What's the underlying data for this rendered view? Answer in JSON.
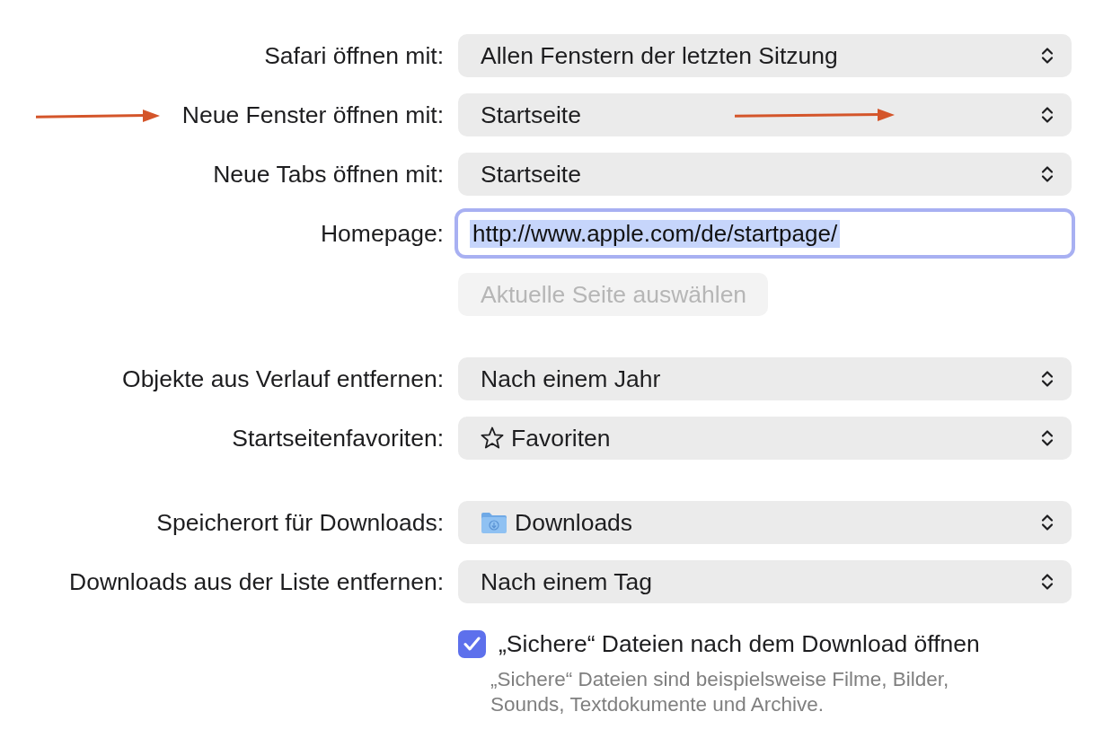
{
  "sections": [
    {
      "rows": [
        {
          "kind": "popup",
          "label": "Safari öffnen mit:",
          "value": "Allen Fenstern der letzten Sitzung",
          "annotated": false
        },
        {
          "kind": "popup",
          "label": "Neue Fenster öffnen mit:",
          "value": "Startseite",
          "annotated": true
        },
        {
          "kind": "popup",
          "label": "Neue Tabs öffnen mit:",
          "value": "Startseite",
          "annotated": false
        },
        {
          "kind": "text_field",
          "label": "Homepage:",
          "value": "http://www.apple.com/de/startpage/",
          "focused": true,
          "text_selected": true,
          "annotated": false
        },
        {
          "kind": "button",
          "text": "Aktuelle Seite auswählen",
          "disabled": true,
          "annotated": false
        }
      ]
    },
    {
      "rows": [
        {
          "kind": "popup",
          "label": "Objekte aus Verlauf entfernen:",
          "value": "Nach einem Jahr",
          "annotated": false
        },
        {
          "kind": "favorites_popup",
          "label": "Startseitenfavoriten:",
          "value": "Favoriten",
          "annotated": false
        }
      ]
    },
    {
      "rows": [
        {
          "kind": "folder_popup",
          "label": "Speicherort für Downloads:",
          "value": "Downloads",
          "annotated": false
        },
        {
          "kind": "popup",
          "label": "Downloads aus der Liste entfernen:",
          "value": "Nach einem Tag",
          "annotated": false
        },
        {
          "kind": "checkbox",
          "text": "„Sichere“ Dateien nach dem Download öffnen",
          "checked": true,
          "description": "„Sichere“ Dateien sind beispielsweise Filme, Bilder, Sounds, Textdokumente und Archive.",
          "annotated": false
        }
      ]
    }
  ]
}
